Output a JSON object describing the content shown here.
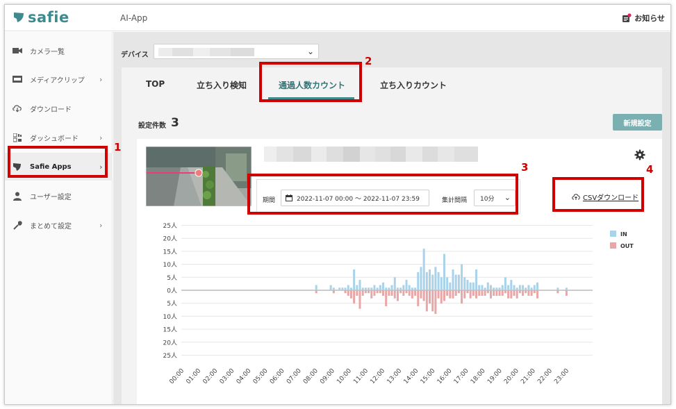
{
  "app": {
    "logo_text": "safie",
    "title": "AI-App",
    "notice_label": "お知らせ",
    "brand_color": "#3e8a8c"
  },
  "sidebar": {
    "items": [
      {
        "label": "カメラ一覧",
        "icon": "video-camera-icon",
        "chevron": false
      },
      {
        "label": "メディアクリップ",
        "icon": "film-icon",
        "chevron": true
      },
      {
        "label": "ダウンロード",
        "icon": "cloud-download-icon",
        "chevron": false
      },
      {
        "label": "ダッシュボード",
        "icon": "dashboard-icon",
        "chevron": true
      },
      {
        "label": "Safie Apps",
        "icon": "safie-leaf-icon",
        "chevron": true,
        "active": true
      },
      {
        "label": "ユーザー設定",
        "icon": "user-icon",
        "chevron": false
      },
      {
        "label": "まとめて設定",
        "icon": "wrench-icon",
        "chevron": true
      }
    ]
  },
  "device": {
    "label": "デバイス"
  },
  "tabs": [
    {
      "label": "TOP"
    },
    {
      "label": "立ち入り検知"
    },
    {
      "label": "通過人数カウント",
      "active": true
    },
    {
      "label": "立ち入りカウント"
    }
  ],
  "settings": {
    "count_label": "設定件数",
    "count_value": "3",
    "new_button": "新規設定"
  },
  "filter": {
    "period_label": "期間",
    "period_value": "2022-11-07 00:00 ～ 2022-11-07 23:59",
    "interval_label": "集計間隔",
    "interval_value": "10分"
  },
  "csv": {
    "label": "CSVダウンロード"
  },
  "annotations": [
    "1",
    "2",
    "3",
    "4"
  ],
  "chart_data": {
    "type": "bar",
    "y_ticks": [
      "25人",
      "20人",
      "15人",
      "10人",
      "5人",
      "0人",
      "5人",
      "10人",
      "15人",
      "20人",
      "25人"
    ],
    "ylim": [
      -25,
      25
    ],
    "x_ticks": [
      "00:00",
      "01:00",
      "02:00",
      "03:00",
      "04:00",
      "05:00",
      "06:00",
      "07:00",
      "08:00",
      "09:00",
      "10:00",
      "11:00",
      "12:00",
      "13:00",
      "14:00",
      "15:00",
      "16:00",
      "17:00",
      "18:00",
      "19:00",
      "20:00",
      "21:00",
      "22:00",
      "23:00"
    ],
    "series": [
      {
        "name": "IN",
        "color": "#a9d3ea",
        "values": [
          0,
          0,
          0,
          0,
          0,
          0,
          0,
          0,
          0,
          0,
          0,
          0,
          0,
          0,
          0,
          0,
          0,
          0,
          0,
          0,
          0,
          0,
          0,
          0,
          0,
          0,
          0,
          0,
          0,
          0,
          0,
          0,
          0,
          0,
          0,
          0,
          0,
          0,
          0,
          0,
          0,
          0,
          0,
          0,
          0,
          0,
          2,
          0,
          0,
          0,
          0,
          2,
          1,
          0,
          1,
          1,
          1,
          2,
          1,
          8,
          2,
          4,
          1,
          1,
          1,
          1,
          2,
          1,
          2,
          3,
          1,
          1,
          2,
          5,
          1,
          1,
          2,
          4,
          2,
          1,
          1,
          7,
          9,
          16,
          7,
          8,
          6,
          9,
          7,
          5,
          14,
          5,
          3,
          8,
          6,
          6,
          10,
          5,
          4,
          3,
          3,
          8,
          2,
          2,
          1,
          3,
          2,
          1,
          1,
          1,
          2,
          5,
          2,
          4,
          2,
          1,
          2,
          2,
          1,
          2,
          1,
          2,
          3,
          0,
          0,
          0,
          0,
          0,
          0,
          1,
          0,
          0,
          1,
          0,
          0,
          0,
          0,
          0
        ]
      },
      {
        "name": "OUT",
        "color": "#e8a6a6",
        "values": [
          0,
          0,
          0,
          0,
          0,
          0,
          0,
          0,
          0,
          0,
          0,
          0,
          0,
          0,
          0,
          0,
          0,
          0,
          0,
          0,
          0,
          0,
          0,
          0,
          0,
          0,
          0,
          0,
          0,
          0,
          0,
          0,
          0,
          0,
          0,
          0,
          0,
          0,
          0,
          0,
          0,
          0,
          0,
          0,
          0,
          0,
          1,
          0,
          0,
          0,
          0,
          0,
          1,
          0,
          0,
          0,
          1,
          2,
          3,
          5,
          2,
          7,
          2,
          1,
          1,
          3,
          2,
          1,
          1,
          2,
          6,
          2,
          2,
          3,
          4,
          1,
          2,
          1,
          2,
          3,
          2,
          6,
          3,
          4,
          8,
          5,
          8,
          9,
          3,
          5,
          4,
          2,
          3,
          3,
          2,
          1,
          5,
          3,
          1,
          3,
          2,
          3,
          2,
          2,
          2,
          1,
          3,
          2,
          2,
          2,
          2,
          1,
          3,
          3,
          2,
          3,
          1,
          2,
          1,
          2,
          2,
          1,
          3,
          0,
          0,
          0,
          0,
          0,
          0,
          1,
          0,
          0,
          2,
          0,
          0,
          0,
          0,
          0
        ]
      }
    ],
    "legend_position": "top-right"
  }
}
